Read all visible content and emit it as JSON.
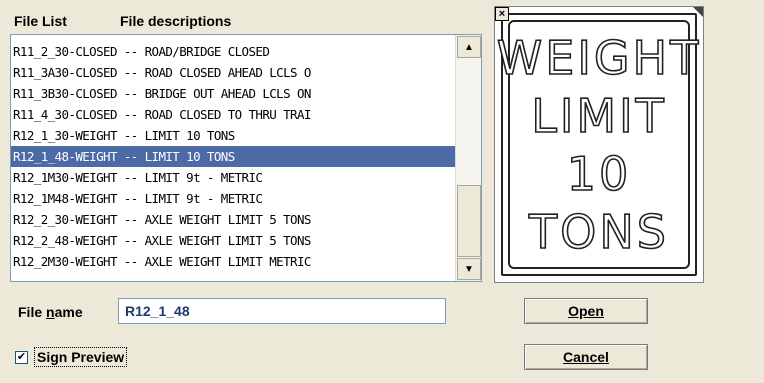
{
  "headers": {
    "file_list": "File List",
    "file_descriptions": "File descriptions"
  },
  "file_list": [
    "R11_2_30-CLOSED -- ROAD/BRIDGE CLOSED",
    "R11_3A30-CLOSED -- ROAD CLOSED AHEAD LCLS O",
    "R11_3B30-CLOSED -- BRIDGE OUT AHEAD LCLS ON",
    "R11_4_30-CLOSED -- ROAD CLOSED TO THRU TRAI",
    "R12_1_30-WEIGHT -- LIMIT 10 TONS",
    "R12_1_48-WEIGHT -- LIMIT 10 TONS",
    "R12_1M30-WEIGHT -- LIMIT 9t - METRIC",
    "R12_1M48-WEIGHT -- LIMIT 9t - METRIC",
    "R12_2_30-WEIGHT -- AXLE WEIGHT LIMIT 5 TONS",
    "R12_2_48-WEIGHT -- AXLE WEIGHT LIMIT 5 TONS",
    "R12_2M30-WEIGHT -- AXLE WEIGHT LIMIT METRIC"
  ],
  "selected_index": 5,
  "preview": {
    "close_glyph": "×",
    "sign_lines": [
      "WEIGHT",
      "LIMIT",
      "10",
      "TONS"
    ]
  },
  "file_name": {
    "label_prefix": "File ",
    "label_mnemonic": "n",
    "label_suffix": "ame",
    "value": "R12_1_48"
  },
  "sign_preview": {
    "label": "Sign Preview",
    "checked": true,
    "check_glyph": "✔"
  },
  "buttons": {
    "open": "Open",
    "cancel": "Cancel"
  },
  "scroll": {
    "up_glyph": "▲",
    "down_glyph": "▼"
  }
}
